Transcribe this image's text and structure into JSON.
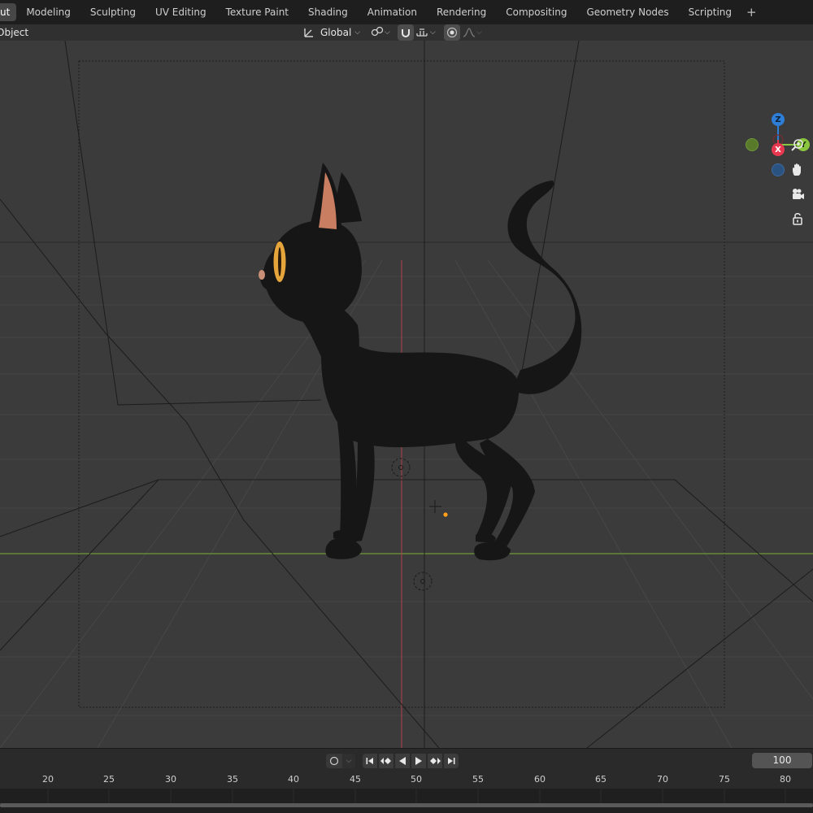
{
  "workspace_tabs": [
    {
      "label": "ut",
      "active": true
    },
    {
      "label": "Modeling"
    },
    {
      "label": "Sculpting"
    },
    {
      "label": "UV Editing"
    },
    {
      "label": "Texture Paint"
    },
    {
      "label": "Shading"
    },
    {
      "label": "Animation"
    },
    {
      "label": "Rendering"
    },
    {
      "label": "Compositing"
    },
    {
      "label": "Geometry Nodes"
    },
    {
      "label": "Scripting"
    }
  ],
  "add_workspace": "+",
  "header": {
    "mode": "Object",
    "orientation": "Global"
  },
  "gizmo": {
    "z": "Z",
    "y": "Y",
    "x": "X",
    "colors": {
      "x": "#e8384f",
      "y": "#8bc53f",
      "z": "#2e7ed7"
    }
  },
  "navigation_icons": [
    "zoom-icon",
    "pan-hand-icon",
    "camera-view-icon",
    "lock-icon"
  ],
  "timeline": {
    "current_frame": "100",
    "ruler_ticks": [
      "20",
      "25",
      "30",
      "35",
      "40",
      "45",
      "50",
      "55",
      "60",
      "65",
      "70",
      "75",
      "80"
    ]
  },
  "colors": {
    "viewport_bg": "#3b3b3b",
    "x_axis": "#c0454f",
    "y_axis": "#6f9a3a",
    "object_origin": "#ff9f1a"
  }
}
